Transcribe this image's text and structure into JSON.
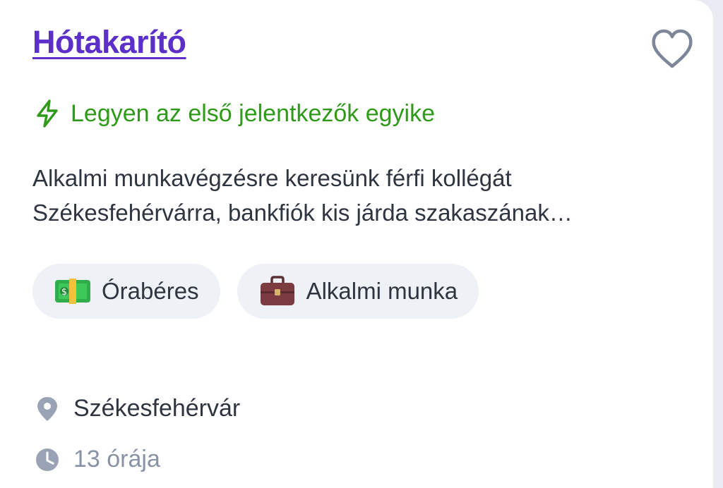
{
  "job": {
    "title": "Hótakarító",
    "early_applicant_text": "Legyen az első jelentkezők egyike",
    "description": "Alkalmi munkavégzésre keresünk férfi kollégát Székesfehérvárra, bankfiók kis járda szakaszának…",
    "tags": [
      {
        "icon": "money-icon",
        "label": "Órabéres"
      },
      {
        "icon": "briefcase-icon",
        "label": "Alkalmi munka"
      }
    ],
    "location": "Székesfehérvár",
    "posted": "13 órája"
  },
  "colors": {
    "title": "#5b2fc8",
    "early_applicant": "#2f9a1a",
    "chip_bg": "#eef1f6",
    "muted": "#8a93a6"
  }
}
